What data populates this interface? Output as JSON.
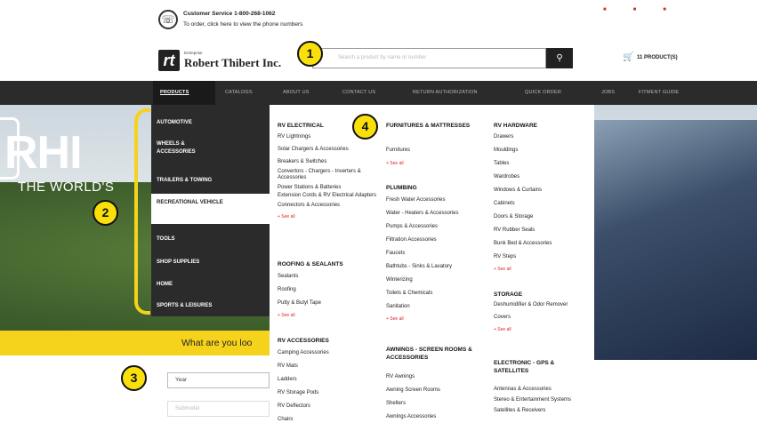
{
  "header": {
    "customer_service": "Customer Service 1-800-268-1062",
    "to_order": "To order, click here to view the phone numbers",
    "logo_small": "Entreprise",
    "logo_name": "Robert Thibert Inc.",
    "search_placeholder": "Search a product by name or number",
    "cart_label": "11 PRODUCT(S)"
  },
  "nav": {
    "items": [
      "PRODUCTS",
      "CATALOGS",
      "ABOUT US",
      "CONTACT US",
      "RETURN AUTHORIZATION",
      "QUICK ORDER",
      "JOBS",
      "FITMENT GUIDE"
    ]
  },
  "sidebar": {
    "items": [
      "AUTOMOTIVE",
      "WHEELS & ACCESSORIES",
      "TRAILERS & TOWING",
      "RECREATIONAL VEHICLE",
      "TOOLS",
      "SHOP SUPPLIES",
      "HOME",
      "SPORTS & LEISURES"
    ]
  },
  "hero": {
    "rhino": "RHI",
    "world": "THE WORLD'S",
    "finder_prompt": "What are you loo",
    "year_label": "Year",
    "submodel_label": "Submodel"
  },
  "mega": {
    "col1": {
      "rv_electrical": "RV ELECTRICAL",
      "rv_electrical_items": [
        "RV Lightnings",
        "Solar Chargers & Accessories",
        "Breakers & Switches",
        "Convertors - Chargers - Inverters & Accessories",
        "Power Stations & Batteries",
        "Extension Cords & RV Electrical Adapters",
        "Connectors & Accessories"
      ],
      "see_all_1": "+ See all",
      "roofing": "ROOFING & SEALANTS",
      "roofing_items": [
        "Sealants",
        "Roofing",
        "Putty & Butyl Tape"
      ],
      "see_all_2": "+ See all",
      "rv_accessories": "RV ACCESSORIES",
      "rv_accessories_items": [
        "Camping Accessories",
        "RV Mats",
        "Ladders",
        "RV Storage Pods",
        "RV Deflectors",
        "Chairs"
      ]
    },
    "col2": {
      "furnitures": "FURNITURES & MATTRESSES",
      "furnitures_items": [
        "Furnitures"
      ],
      "see_all_1": "+ See all",
      "plumbing": "PLUMBING",
      "plumbing_items": [
        "Fresh Water Accessories",
        "Water - Heaters & Accessories",
        "Pumps & Accessories",
        "Filtration Accessories",
        "Faucets",
        "Bathtubs - Sinks & Lavatory",
        "Winterizing",
        "Toilets & Chemicals",
        "Sanitation"
      ],
      "see_all_2": "+ See all",
      "awnings": "AWNINGS - SCREEN ROOMS & ACCESSORIES",
      "awnings_items": [
        "RV Awnings",
        "Awning Screen Rooms",
        "Shelters",
        "Awnings Accessories"
      ]
    },
    "col3": {
      "hardware": "RV HARDWARE",
      "hardware_items": [
        "Drawers",
        "Mouldings",
        "Tables",
        "Wardrobes",
        "Windows & Curtains",
        "Cabinets",
        "Doors & Storage",
        "RV Rubber Seals",
        "Bunk Bed & Accessories",
        "RV Steps"
      ],
      "see_all_1": "+ See all",
      "storage": "STORAGE",
      "storage_items": [
        "Deshumidifier & Odor Remover",
        "Covers"
      ],
      "see_all_2": "+ See all",
      "electronic": "ELECTRONIC - GPS & SATELLITES",
      "electronic_items": [
        "Antennas & Accessories",
        "Stereo & Entertainment Systems",
        "Satellites & Receivers"
      ]
    }
  },
  "callouts": [
    "1",
    "2",
    "3",
    "4"
  ],
  "colors": {
    "callout": "#f9e00b",
    "nav_bg": "#2b2b2b",
    "accent_red": "#d22222"
  },
  "icons": [
    "phone-icon",
    "search-icon",
    "cart-icon"
  ]
}
